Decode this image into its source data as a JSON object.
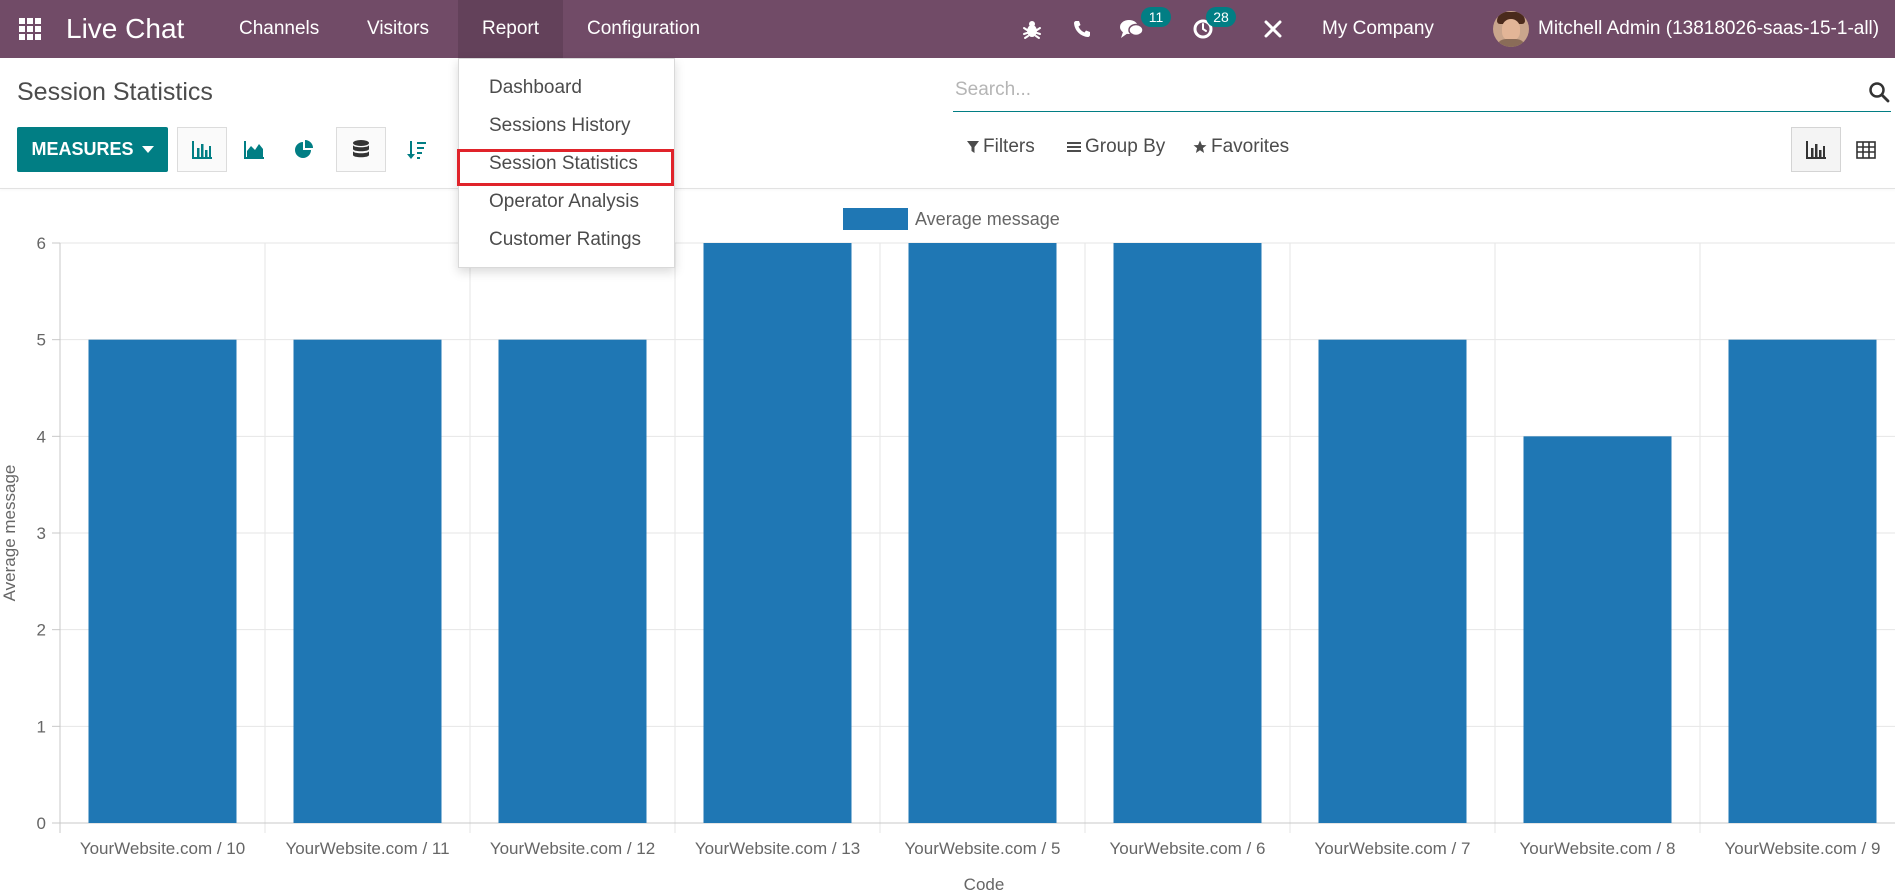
{
  "navbar": {
    "app_title": "Live Chat",
    "menus": [
      "Channels",
      "Visitors",
      "Report",
      "Configuration"
    ],
    "chat_badge": "11",
    "activity_badge": "28",
    "company": "My Company",
    "user": "Mitchell Admin (13818026-saas-15-1-all)",
    "icons": [
      "apps-icon",
      "bug-icon",
      "phone-icon",
      "chat-icon",
      "activity-icon",
      "tools-icon"
    ]
  },
  "report_menu": {
    "items": [
      "Dashboard",
      "Sessions History",
      "Session Statistics",
      "Operator Analysis",
      "Customer Ratings"
    ],
    "highlighted": "Session Statistics"
  },
  "control_panel": {
    "title": "Session Statistics",
    "search_placeholder": "Search...",
    "measures_label": "MEASURES",
    "filters_label": "Filters",
    "group_by_label": "Group By",
    "favorites_label": "Favorites"
  },
  "chart_data": {
    "type": "bar",
    "categories": [
      "YourWebsite.com / 10",
      "YourWebsite.com / 11",
      "YourWebsite.com / 12",
      "YourWebsite.com / 13",
      "YourWebsite.com / 5",
      "YourWebsite.com / 6",
      "YourWebsite.com / 7",
      "YourWebsite.com / 8",
      "YourWebsite.com / 9"
    ],
    "series": [
      {
        "name": "Average message",
        "values": [
          5,
          5,
          5,
          6,
          6,
          6,
          5,
          4,
          5
        ]
      }
    ],
    "xlabel": "Code",
    "ylabel": "Average message",
    "ylim": [
      0,
      6
    ],
    "yticks": [
      0,
      1,
      2,
      3,
      4,
      5,
      6
    ],
    "grid": true,
    "legend": "top-center",
    "color": "#1f77b4"
  }
}
